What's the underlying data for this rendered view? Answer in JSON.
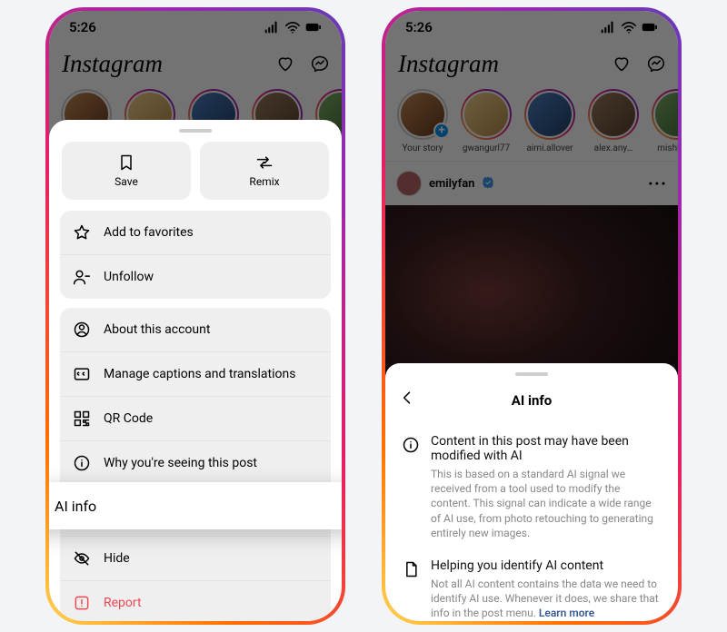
{
  "status": {
    "time": "5:26"
  },
  "app": {
    "logo_text": "Instagram"
  },
  "stories": [
    {
      "name": "Your story"
    },
    {
      "name": "gwangurl77"
    },
    {
      "name": "aimi.allover"
    },
    {
      "name": "alex.any…"
    },
    {
      "name": "mishka_…"
    }
  ],
  "post": {
    "username": "emilyfan"
  },
  "sheet1": {
    "save": "Save",
    "remix": "Remix",
    "add_favorites": "Add to favorites",
    "unfollow": "Unfollow",
    "about_account": "About this account",
    "captions": "Manage captions and translations",
    "qr": "QR Code",
    "why_seeing": "Why you're seeing this post",
    "ai_info": "AI info",
    "hide": "Hide",
    "report": "Report"
  },
  "sheet2": {
    "title": "AI info",
    "block1_title": "Content in this post may have been modified with AI",
    "block1_body": "This is based on a standard AI signal we received from a tool used to modify the content. This signal can indicate a wide range of AI use, from photo retouching to generating entirely new images.",
    "block2_title": "Helping you identify AI content",
    "block2_body": "Not all AI content contains the data we need to identify AI use. Whenever it does, we share that info in the post menu. ",
    "learn_more": "Learn more"
  }
}
